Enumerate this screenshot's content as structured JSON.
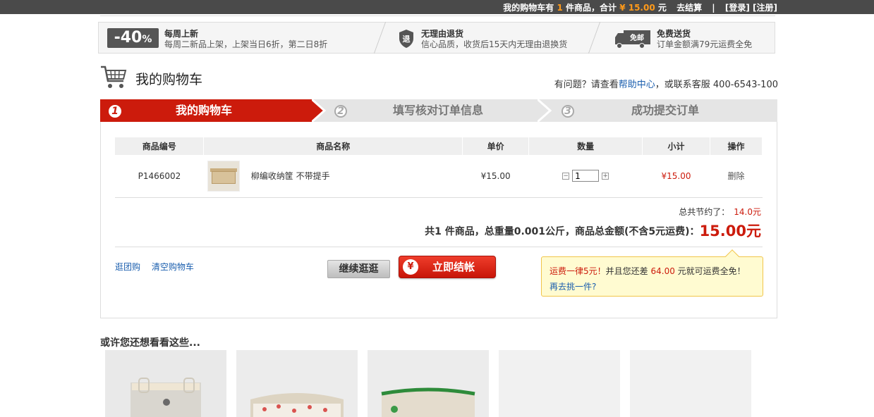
{
  "topbar": {
    "cart_prefix": "我的购物车有",
    "count": "1",
    "cart_mid": "件商品，合计",
    "total": "¥ 15.00",
    "total_unit": "元",
    "checkout": "去结算",
    "divider": "|",
    "login": "[登录]",
    "register": "[注册]"
  },
  "promo": {
    "discount": "-40",
    "percent": "%",
    "p1_title": "每周上新",
    "p1_desc": "每周二新品上架，上架当日6折，第二日8折",
    "p2_icon_text": "退",
    "p2_title": "无理由退货",
    "p2_desc": "信心品质，收货后15天内无理由退换货",
    "p3_icon_text": "免邮",
    "p3_title": "免费送货",
    "p3_desc": "订单金额满79元运费全免"
  },
  "header": {
    "title": "我的购物车",
    "help_prefix": "有问题？请查看",
    "help_link": "帮助中心",
    "help_suffix": "，或联系客服 400-6543-100"
  },
  "steps": [
    {
      "num": "1",
      "label": "我的购物车"
    },
    {
      "num": "2",
      "label": "填写核对订单信息"
    },
    {
      "num": "3",
      "label": "成功提交订单"
    }
  ],
  "table": {
    "headers": [
      "商品编号",
      "商品名称",
      "单价",
      "数量",
      "小计",
      "操作"
    ],
    "rows": [
      {
        "sku": "P1466002",
        "name": "柳编收纳筐 不带提手",
        "price": "¥15.00",
        "qty": "1",
        "minus": "−",
        "plus": "+",
        "subtotal": "¥15.00",
        "action": "删除"
      }
    ]
  },
  "summary": {
    "saved_label": "总共节约了：",
    "saved_value": "14.0元",
    "total_text": "共1 件商品，总重量0.001公斤，商品总金额(不含5元运费)：",
    "total_value": "15.00元"
  },
  "links": {
    "group_buy": "逛团购",
    "clear_cart": "清空购物车"
  },
  "buttons": {
    "continue": "继续逛逛",
    "checkout_icon": "¥",
    "checkout": "立即结帐"
  },
  "tip": {
    "l1_a": "运费一律5元！",
    "l1_b": "并且您还差",
    "l1_c": "64.00",
    "l1_d": "元就可运费全免！",
    "l2": "再去挑一件?"
  },
  "recommend": {
    "title": "或许您还想看看这些..."
  },
  "colors": {
    "accent_red": "#cc1b0c",
    "link_blue": "#1a5eae",
    "topbar_bg": "#4a4a4a",
    "orange": "#ff9a1a"
  }
}
